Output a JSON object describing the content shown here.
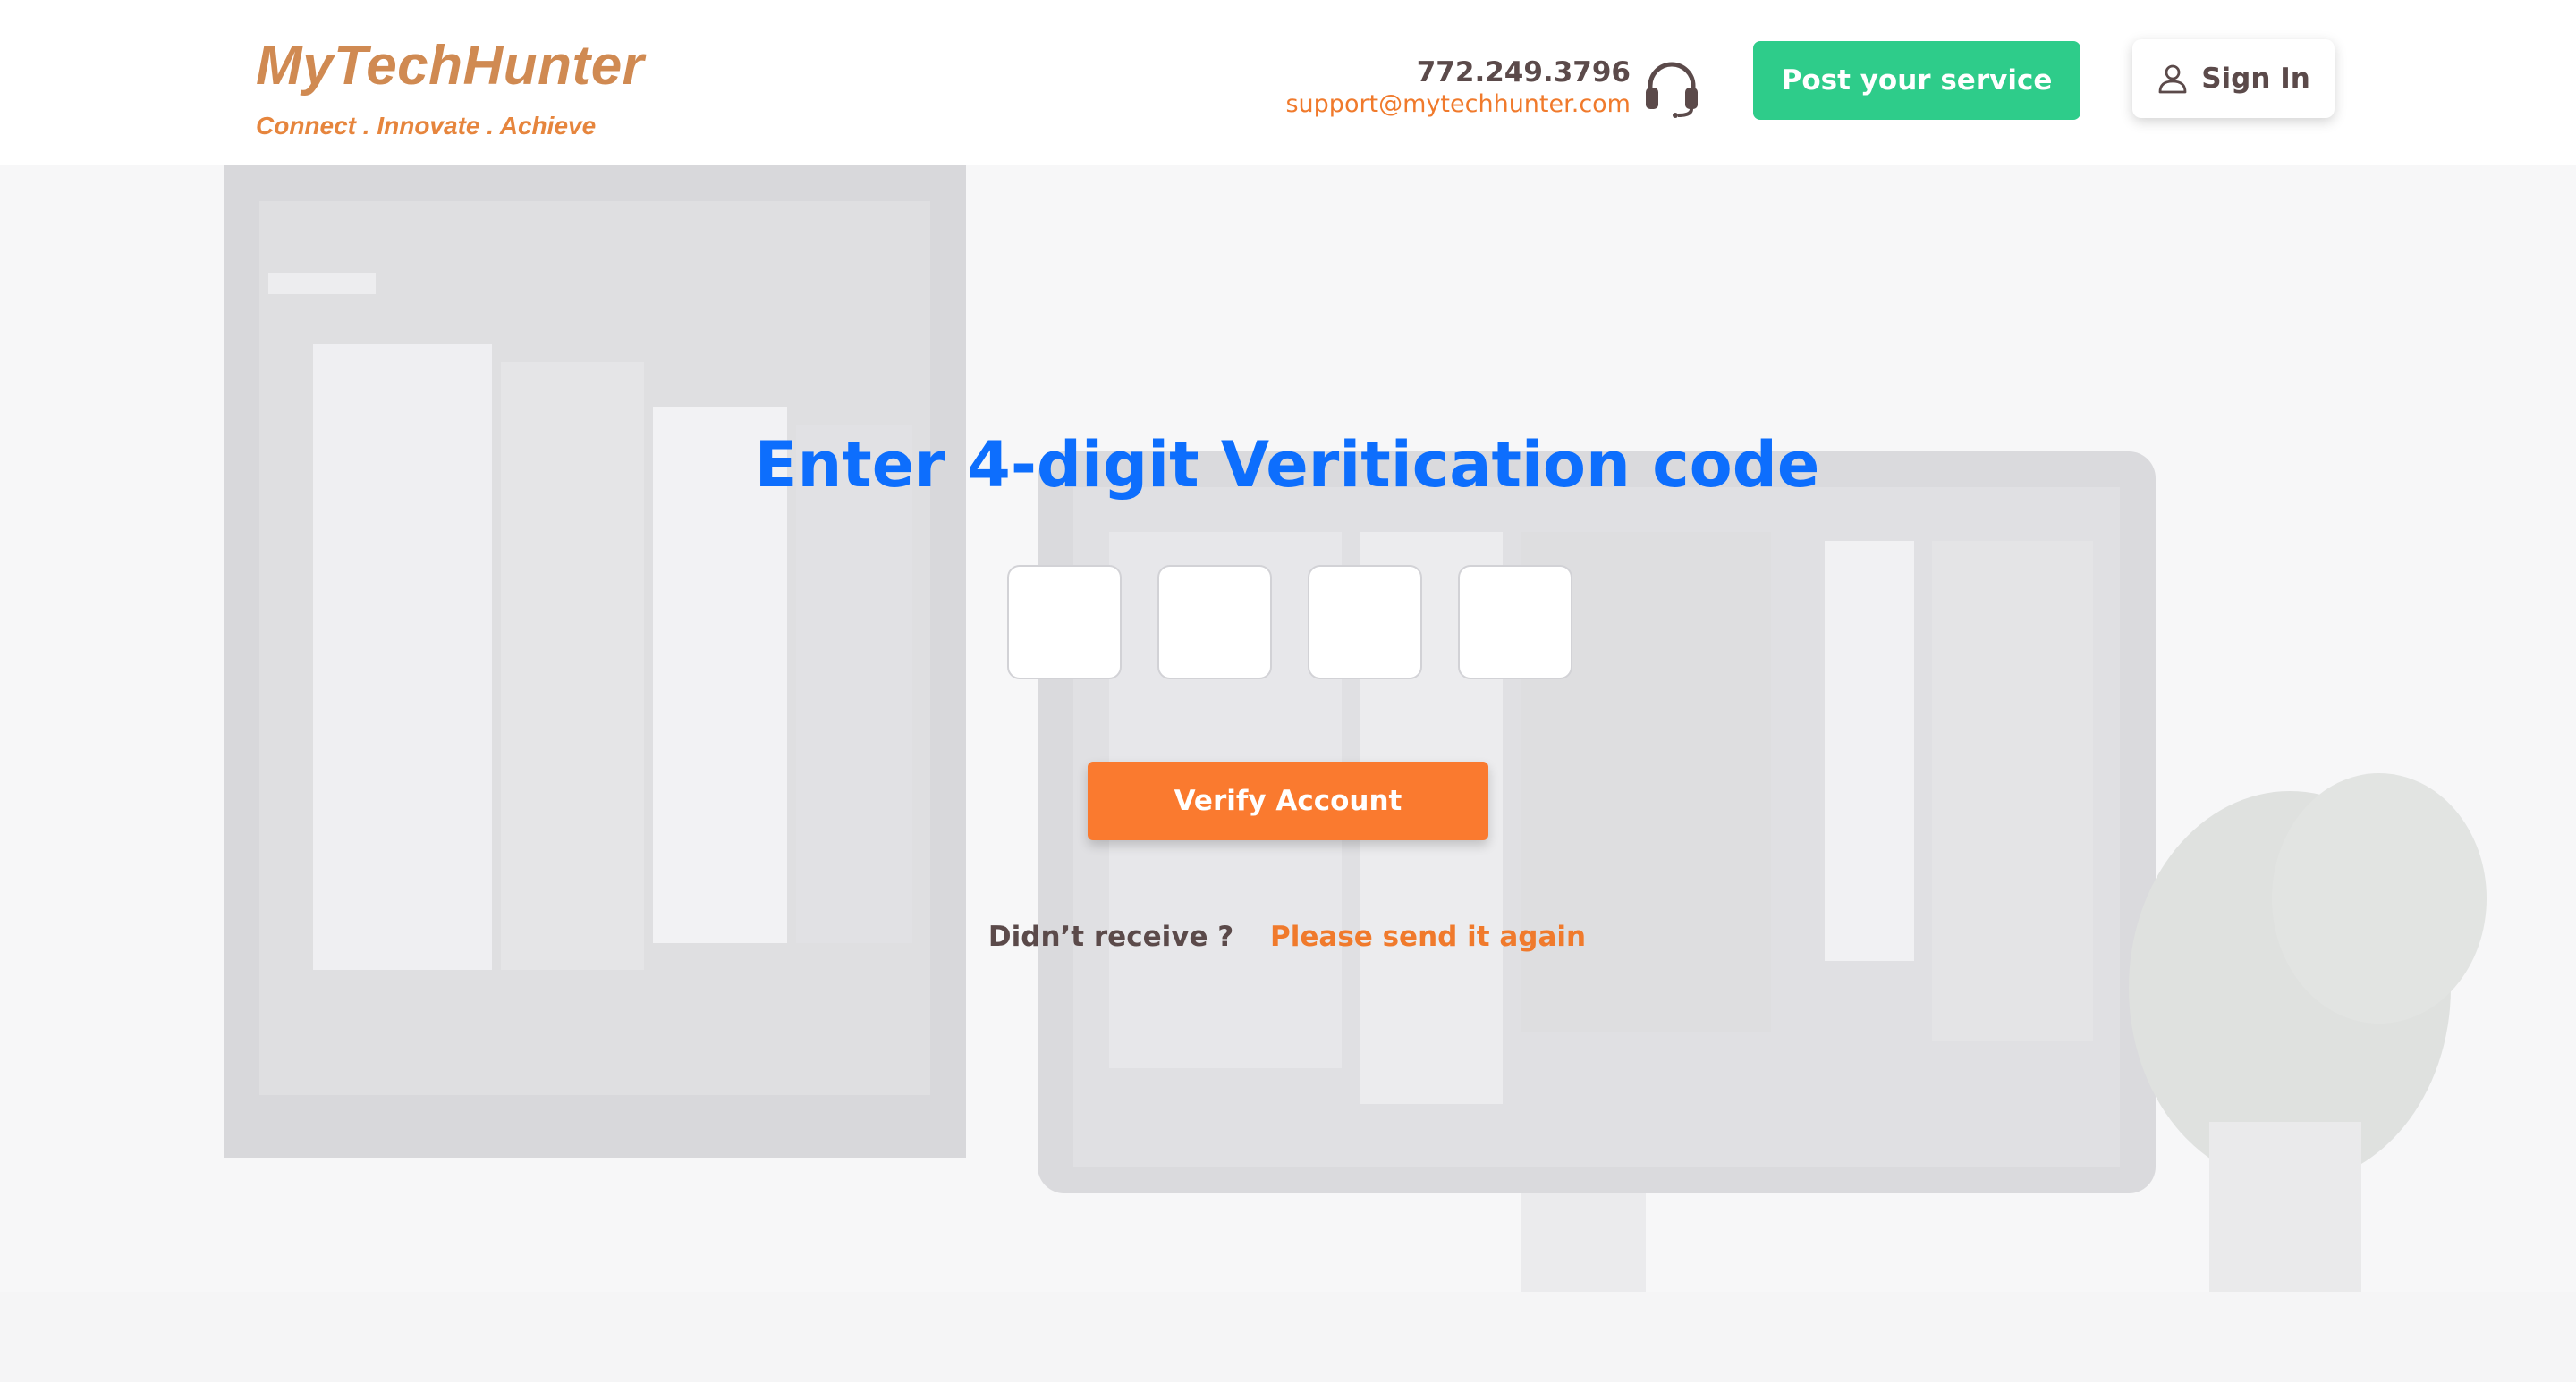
{
  "brand": {
    "name": "MyTechHunter",
    "tagline": "Connect . Innovate . Achieve"
  },
  "contact": {
    "phone": "772.249.3796",
    "email": "support@mytechhunter.com",
    "icon": "headset-icon"
  },
  "nav": {
    "post_label": "Post your service",
    "signin_label": "Sign In",
    "signin_icon": "user-icon"
  },
  "verification": {
    "title": "Enter 4-digit Veritication code",
    "digits": [
      "",
      "",
      "",
      ""
    ],
    "verify_label": "Verify Account",
    "resend_prompt": "Didn’t receive ?",
    "resend_link": "Please send it again"
  },
  "colors": {
    "accent_orange": "#fa7a2c",
    "brand_orange": "#d08a52",
    "title_blue": "#0d6efd",
    "post_green": "#2ecc8a",
    "dark_text": "#5b4a4a"
  }
}
